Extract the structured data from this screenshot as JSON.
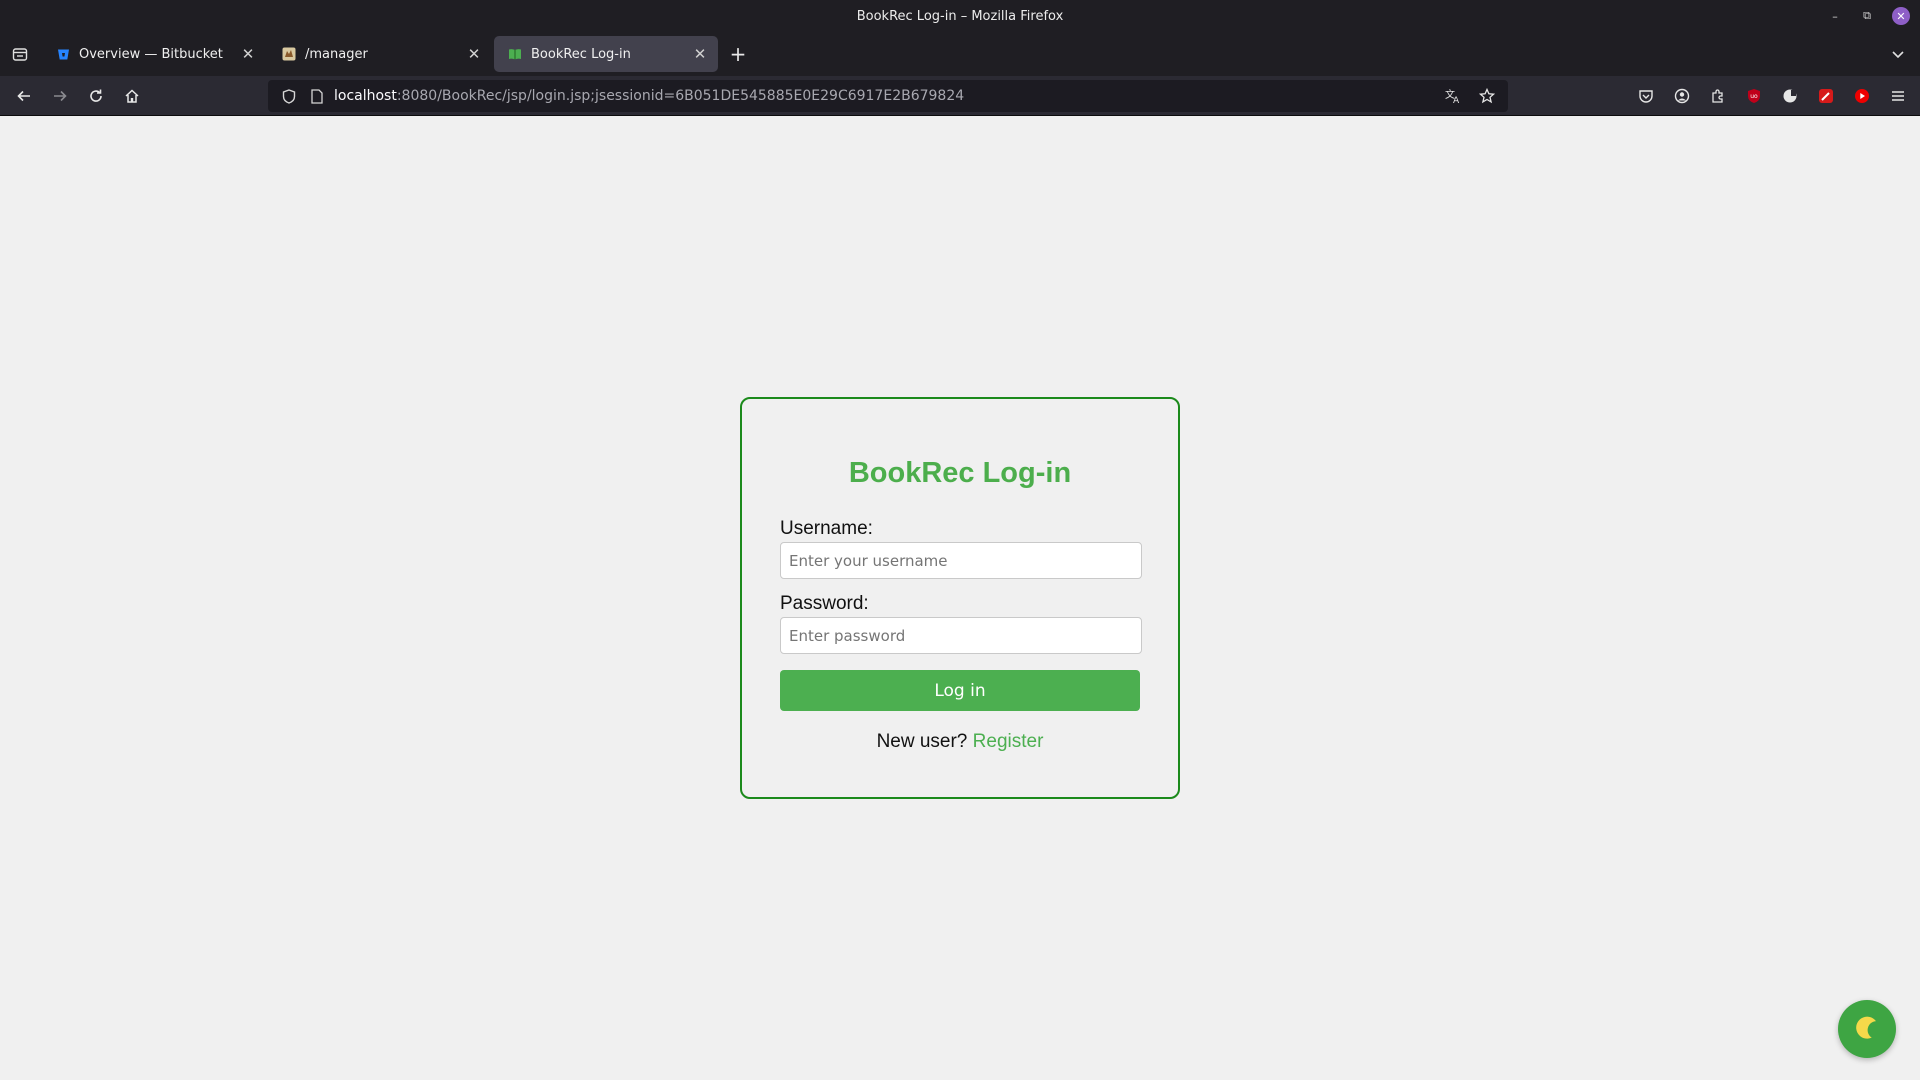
{
  "window": {
    "title": "BookRec Log-in – Mozilla Firefox"
  },
  "tabs": [
    {
      "label": "Overview — Bitbucket",
      "icon": "bitbucket-icon",
      "active": false
    },
    {
      "label": "/manager",
      "icon": "tomcat-icon",
      "active": false
    },
    {
      "label": "BookRec Log-in",
      "icon": "book-icon",
      "active": true
    }
  ],
  "urlbar": {
    "host": "localhost",
    "path": ":8080/BookRec/jsp/login.jsp;jsessionid=6B051DE545885E0E29C6917E2B679824"
  },
  "login": {
    "title": "BookRec Log-in",
    "username_label": "Username:",
    "username_placeholder": "Enter your username",
    "username_value": "",
    "password_label": "Password:",
    "password_placeholder": "Enter password",
    "password_value": "",
    "submit_label": "Log in",
    "new_user_text": "New user?",
    "register_label": "Register"
  },
  "colors": {
    "accent": "#4caf50",
    "title": "#4cae4c",
    "card_border": "#1b8a1b",
    "page_bg": "#f0f0f0"
  }
}
